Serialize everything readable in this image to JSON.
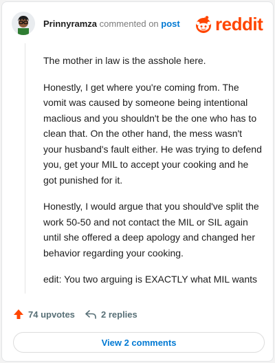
{
  "header": {
    "username": "Prinnyramza",
    "action_text": " commented on ",
    "link_text": "post"
  },
  "logo": {
    "text": "reddit",
    "icon": "reddit-alien-icon",
    "color": "#ff4500"
  },
  "comment": {
    "paragraphs": [
      "The mother in law is the asshole here.",
      "Honestly, I get where you're coming from. The vomit was caused by someone being intentional maclious and you shouldn't be the one who has to clean that. On the other hand, the mess wasn't your husband's fault either. He was trying to defend you, get your MIL to accept your cooking and he got punished for it.",
      "Honestly, I would argue that you should've split the work 50-50 and not contact the MIL or SIL again until she offered a deep apology and changed her behavior regarding your cooking.",
      "edit: You two arguing is EXACTLY what MIL wants"
    ]
  },
  "actions": {
    "upvotes": "74 upvotes",
    "replies": "2 replies",
    "upvote_icon": "upvote-arrow-icon",
    "reply_icon": "reply-arrow-icon"
  },
  "footer": {
    "view_comments": "View 2 comments"
  },
  "colors": {
    "accent": "#ff4500",
    "link": "#0079d3",
    "muted": "#576f76"
  }
}
